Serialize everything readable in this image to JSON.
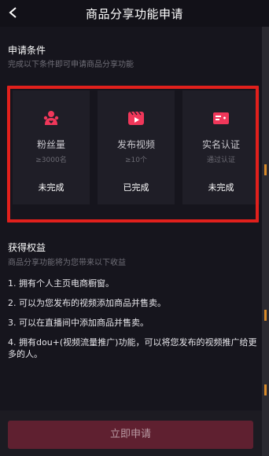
{
  "header": {
    "title": "商品分享功能申请"
  },
  "conditions": {
    "title": "申请条件",
    "subtitle": "完成以下条件即可申请商品分享功能",
    "cards": [
      {
        "icon": "fans-icon",
        "label": "粉丝量",
        "requirement": "≥3000名",
        "status": "未完成"
      },
      {
        "icon": "video-icon",
        "label": "发布视频",
        "requirement": "≥10个",
        "status": "已完成"
      },
      {
        "icon": "id-card-icon",
        "label": "实名认证",
        "requirement": "通过认证",
        "status": "未完成"
      }
    ]
  },
  "benefits": {
    "title": "获得权益",
    "subtitle": "商品分享功能将为您带来以下收益",
    "items": [
      "1. 拥有个人主页电商橱窗。",
      "2. 可以为您发布的视频添加商品并售卖。",
      "3. 可以在直播间中添加商品并售卖。",
      "4. 拥有dou+(视频流量推广)功能，可以将您发布的视频推广给更多的人。"
    ]
  },
  "footer": {
    "apply_label": "立即申请"
  },
  "colors": {
    "accent": "#f0375a",
    "highlight_border": "#e1201c",
    "apply_button": "#5f2030"
  }
}
